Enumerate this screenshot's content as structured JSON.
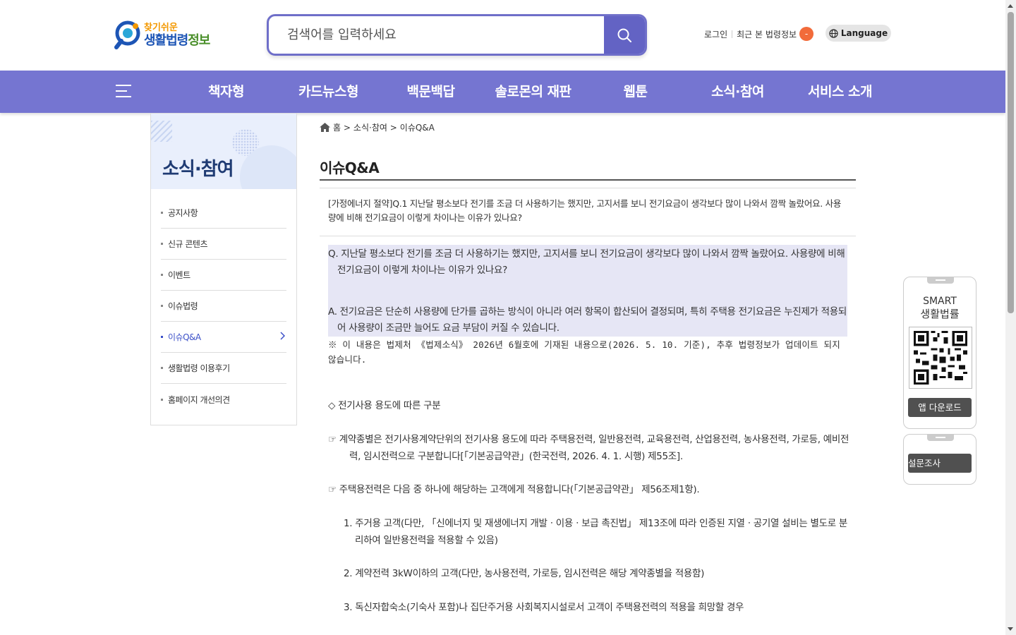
{
  "header": {
    "logo_line1": "찾기쉬운",
    "logo_line2a": "생활법령",
    "logo_line2b": "정보",
    "search_placeholder": "검색어를 입력하세요",
    "login": "로그인",
    "recent": "최근 본 법령정보",
    "recent_badge": "-",
    "language": "Language"
  },
  "nav": {
    "items": [
      "책자형",
      "카드뉴스형",
      "백문백답",
      "솔로몬의 재판",
      "웹툰",
      "소식·참여",
      "서비스 소개"
    ]
  },
  "sidebar": {
    "title": "소식·참여",
    "items": [
      "공지사항",
      "신규 콘텐츠",
      "이벤트",
      "이슈법령",
      "이슈Q&A",
      "생활법령 이용후기",
      "홈페이지 개선의견"
    ],
    "active_index": 4
  },
  "breadcrumb": {
    "home": "홈 >",
    "section": "소식·참여 >",
    "page": "이슈Q&A"
  },
  "content": {
    "title": "이슈Q&A",
    "question_heading": "[가정에너지 절약]Q.1 지난달 평소보다 전기를 조금 더 사용하기는 했지만, 고지서를 보니 전기요금이 생각보다 많이 나와서 깜짝 놀랐어요. 사용량에 비해 전기요금이 이렇게 차이나는 이유가 있나요?",
    "q": "Q. 지난달 평소보다 전기를 조금 더 사용하기는 했지만, 고지서를 보니 전기요금이 생각보다 많이 나와서 깜짝 놀랐어요. 사용량에 비해 전기요금이 이렇게 차이나는 이유가 있나요?",
    "a": "A.  전기요금은 단순히 사용량에 단가를 곱하는 방식이 아니라 여러 항목이 합산되어 결정되며, 특히 주택용 전기요금은 누진제가 적용되어 사용량이 조금만 늘어도 요금 부담이 커질 수 있습니다.",
    "notice": "※ 이 내용은 법제처 《법제소식》 2026년 6월호에 기재된 내용으로(2026. 5. 10. 기준), 추후 법령정보가 업데이트 되지 않습니다.",
    "p1": "◇ 전기사용 용도에 따른 구분",
    "p2": "☞ 계약종별은 전기사용계약단위의 전기사용 용도에 따라 주택용전력, 일반용전력, 교육용전력, 산업용전력, 농사용전력, 가로등, 예비전력, 임시전력으로 구분합니다[「기본공급약관」(한국전력, 2026. 4. 1. 시행) 제55조].",
    "p3": "☞ 주택용전력은 다음 중 하나에 해당하는 고객에게 적용합니다(「기본공급약관」 제56조제1항).",
    "li1": "1. 주거용 고객(다만, 「신에너지 및 재생에너지 개발ㆍ이용ㆍ보급 촉진법」 제13조에 따라 인증된 지열ㆍ공기열 설비는 별도로 분리하여 일반용전력을 적용할 수 있음)",
    "li2": "2. 계약전력 3kW이하의 고객(다만, 농사용전력, 가로등, 임시전력은 해당 계약종별을 적용함)",
    "li3": "3. 독신자합숙소(기숙사 포함)나 집단주거용 사회복지시설로서 고객이 주택용전력의 적용을 희망할 경우"
  },
  "side_float": {
    "smart_line1": "SMART",
    "smart_line2": "생활법률",
    "app_download": "앱 다운로드",
    "survey": "설문조사"
  },
  "colors": {
    "nav_bg": "#7575d1",
    "search_border": "#6f6fc9",
    "active_link": "#3b50c8"
  }
}
